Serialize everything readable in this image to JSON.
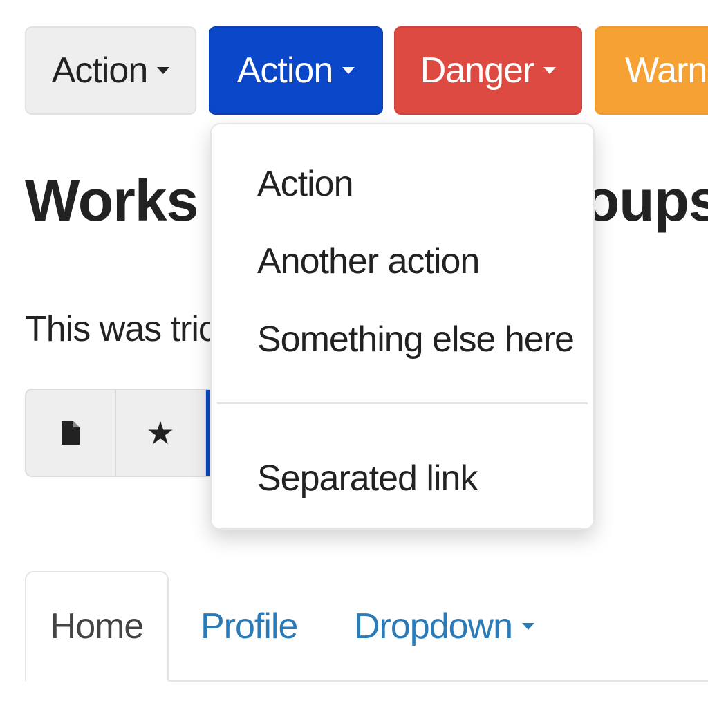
{
  "buttons": {
    "default_label": "Action",
    "primary_label": "Action",
    "danger_label": "Danger",
    "warning_label": "Warnin"
  },
  "dropdown": {
    "items": [
      "Action",
      "Another action",
      "Something else here"
    ],
    "separated": "Separated link"
  },
  "heading": {
    "start": "Works",
    "end": "oups"
  },
  "lead": "This was trick",
  "tabs": {
    "home": "Home",
    "profile": "Profile",
    "dropdown": "Dropdown"
  },
  "icons": [
    "caret-down-icon",
    "file-icon",
    "star-icon"
  ],
  "colors": {
    "primary": "#0a47c9",
    "danger": "#dd4a41",
    "warning": "#f5a133",
    "default": "#eeeeee",
    "link": "#2a7bb8"
  }
}
